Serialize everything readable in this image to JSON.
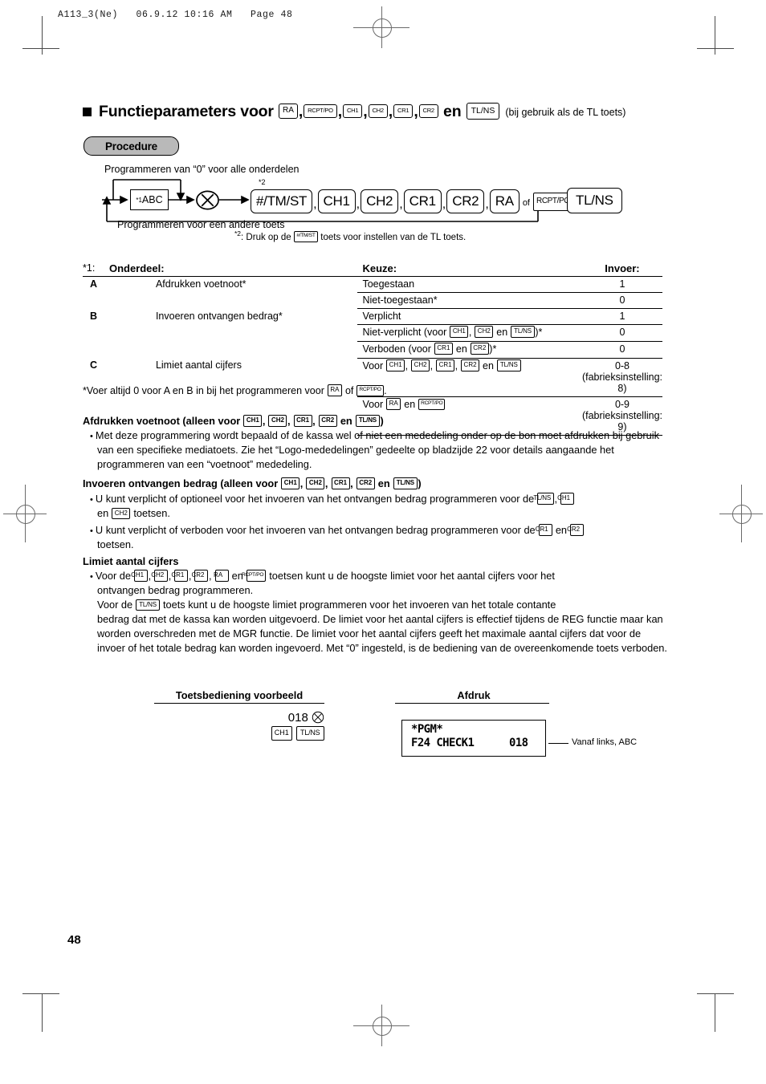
{
  "print_slug": "A113_3(Ne)   06.9.12 10:16 AM   Page 48",
  "title": {
    "bullet": "square-bullet",
    "text": "Functieparameters voor",
    "keys_1": [
      "RA",
      "RCPT/PO",
      "CH1",
      "CH2",
      "CR1",
      "CR2"
    ],
    "en": "en",
    "key_tlns": "TL/NS",
    "tail": "(bij gebruik als de TL toets)"
  },
  "procedure": {
    "badge": "Procedure",
    "caption_top": "Programmeren van “0” voor alle onderdelen",
    "caption_bottom": "Programmeren voor een andere toets",
    "abc_box_sup": "*1",
    "abc_box_label": "ABC",
    "multiply_icon": "multiply-circle-icon",
    "star2_marker": "*2",
    "keys": [
      "#/TM/ST",
      "CH1",
      "CH2",
      "CR1",
      "CR2",
      "RA"
    ],
    "of_label": "of",
    "key_rcptpo": "RCPT/PO",
    "key_tlns": "TL/NS",
    "footnote": {
      "marker": "*2",
      "text_before": ": Druk op de",
      "key": "#/TM/ST",
      "text_after": "toets voor instellen van de TL toets."
    }
  },
  "table": {
    "note_prefix": "*1:",
    "headers": {
      "onderdeel": "Onderdeel:",
      "keuze": "Keuze:",
      "invoer": "Invoer:"
    },
    "rows": [
      {
        "id": "A",
        "item": "Afdrukken voetnoot*",
        "choices": [
          {
            "text": "Toegestaan",
            "keys": [],
            "value": "1"
          },
          {
            "text": "Niet-toegestaan*",
            "keys": [],
            "value": "0"
          }
        ]
      },
      {
        "id": "B",
        "item": "Invoeren ontvangen bedrag*",
        "choices": [
          {
            "text": "Verplicht",
            "keys": [],
            "value": "1"
          },
          {
            "text": "Niet-verplicht (voor CH1, CH2 en TL/NS)*",
            "keys": [
              "CH1",
              "CH2",
              "TL/NS"
            ],
            "value": "0"
          },
          {
            "text": "Verboden (voor CR1 en CR2)*",
            "keys": [
              "CR1",
              "CR2"
            ],
            "value": "0"
          }
        ]
      },
      {
        "id": "C",
        "item": "Limiet aantal cijfers",
        "choices": [
          {
            "text": "Voor CH1, CH2, CR1, CR2 en TL/NS",
            "keys": [
              "CH1",
              "CH2",
              "CR1",
              "CR2",
              "TL/NS"
            ],
            "value": "0-8 (fabrieksinstelling: 8)"
          },
          {
            "text": "Voor RA en RCPT/PO",
            "keys": [
              "RA",
              "RCPT/PO"
            ],
            "value": "0-9 (fabrieksinstelling: 9)"
          }
        ]
      }
    ],
    "footnote_before": "*Voer altijd 0 voor A en B in bij het programmeren voor",
    "footnote_key1": "RA",
    "footnote_mid": "of",
    "footnote_key2": "RCPT/PO",
    "footnote_end": "."
  },
  "sections": [
    {
      "heading_before": "Afdrukken voetnoot (alleen voor",
      "heading_keys": [
        "CH1",
        "CH2",
        "CR1",
        "CR2"
      ],
      "heading_en": "en",
      "heading_key_last": "TL/NS",
      "heading_after": ")",
      "bullets": [
        "Met deze programmering wordt bepaald of de kassa wel of niet een mededeling onder op de bon moet afdrukken bij gebruik van een specifieke mediatoets. Zie het “Logo-mededelingen” gedeelte op bladzijde 22 voor details aangaande het programmeren van een “voetnoot” mededeling."
      ]
    },
    {
      "heading_before": "Invoeren ontvangen bedrag (alleen voor",
      "heading_keys": [
        "CH1",
        "CH2",
        "CR1",
        "CR2"
      ],
      "heading_en": "en",
      "heading_key_last": "TL/NS",
      "heading_after": ")"
    }
  ],
  "body": {
    "b1_l1": "U kunt verplicht of optioneel voor het invoeren van het ontvangen bedrag programmeren voor de",
    "b1_k1": "TL/NS",
    "b1_k2": "CH1",
    "b1_l2a": "en",
    "b1_k3": "CH2",
    "b1_l2b": "toetsen.",
    "b2_l1": "U kunt verplicht of verboden voor het invoeren van het ontvangen bedrag programmeren voor de",
    "b2_k1": "CR1",
    "b2_en": "en",
    "b2_k2": "CR2",
    "b2_l2": "toetsen.",
    "h3": "Limiet aantal cijfers",
    "b3_l1": "Voor de",
    "b3_keys": [
      "CH1",
      "CH2",
      "CR1",
      "CR2",
      "RA",
      "RCPT/PO"
    ],
    "b3_l1b": "toetsen kunt u de hoogste limiet voor het aantal cijfers voor het",
    "b3_l2": "ontvangen bedrag programmeren.",
    "b3_l3a": "Voor de",
    "b3_k_tlns": "TL/NS",
    "b3_l3b": "toets kunt u de hoogste limiet programmeren voor het invoeren van het totale contante",
    "b3_rest": "bedrag dat met de kassa kan worden uitgevoerd. De limiet voor het aantal cijfers is effectief tijdens de REG functie maar kan worden overschreden met de MGR functie. De limiet voor het aantal cijfers geeft het maximale aantal cijfers dat voor de invoer of het totale bedrag kan worden ingevoerd. Met “0” ingesteld, is de bediening van de overeenkomende toets verboden."
  },
  "example": {
    "head_left": "Toetsbediening voorbeeld",
    "head_right": "Afdruk",
    "keys_number": "018",
    "keys_multiply": "multiply-circle-icon",
    "key_ch1": "CH1",
    "key_tlns": "TL/NS",
    "receipt_line1": "*PGM*",
    "receipt_line2_left": "F24 CHECK1",
    "receipt_line2_right": "018",
    "lead_label": "Vanaf links, ABC"
  },
  "page_number": "48"
}
